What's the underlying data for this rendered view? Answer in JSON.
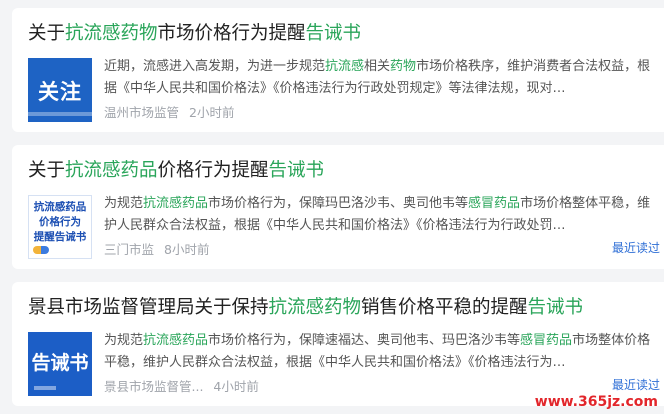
{
  "articles": [
    {
      "title_parts": [
        {
          "text": "关于",
          "hl": false
        },
        {
          "text": "抗流感药物",
          "hl": true
        },
        {
          "text": "市场价格行为提醒",
          "hl": false
        },
        {
          "text": "告诫书",
          "hl": true
        }
      ],
      "thumb_text": "关注",
      "summary_parts": [
        {
          "text": "近期，流感进入高发期，为进一步规范",
          "hl": false
        },
        {
          "text": "抗流感",
          "hl": true
        },
        {
          "text": "相关",
          "hl": false
        },
        {
          "text": "药物",
          "hl": true
        },
        {
          "text": "市场价格秩序，维护消费者合法权益，根据《中华人民共和国价格法》《价格违法行为行政处罚规定》等法律法规，现对…",
          "hl": false
        }
      ],
      "source": "温州市场监管",
      "time": "2小时前",
      "recent": ""
    },
    {
      "title_parts": [
        {
          "text": "关于",
          "hl": false
        },
        {
          "text": "抗流感药品",
          "hl": true
        },
        {
          "text": "价格行为提醒",
          "hl": false
        },
        {
          "text": "告诫书",
          "hl": true
        }
      ],
      "thumb_lines": [
        "抗流感药品",
        "价格行为",
        "提醒告诫书"
      ],
      "summary_parts": [
        {
          "text": "为规范",
          "hl": false
        },
        {
          "text": "抗流感药品",
          "hl": true
        },
        {
          "text": "市场价格行为，保障玛巴洛沙韦、奥司他韦等",
          "hl": false
        },
        {
          "text": "感冒药品",
          "hl": true
        },
        {
          "text": "市场价格整体平稳，维护人民群众合法权益，根据《中华人民共和国价格法》《价格违法行为行政处罚…",
          "hl": false
        }
      ],
      "source": "三门市监",
      "time": "8小时前",
      "recent": "最近读过"
    },
    {
      "title_parts": [
        {
          "text": "景县市场监督管理局关于保持",
          "hl": false
        },
        {
          "text": "抗流感药物",
          "hl": true
        },
        {
          "text": "销售价格平稳的提醒",
          "hl": false
        },
        {
          "text": "告诫书",
          "hl": true
        }
      ],
      "thumb_text": "告诫书",
      "summary_parts": [
        {
          "text": "为规范",
          "hl": false
        },
        {
          "text": "抗流感药品",
          "hl": true
        },
        {
          "text": "市场价格行为，保障速福达、奥司他韦、玛巴洛沙韦等",
          "hl": false
        },
        {
          "text": "感冒药品",
          "hl": true
        },
        {
          "text": "市场整体价格平稳，维护人民群众合法权益，根据《中华人民共和国价格法》《价格违法行为…",
          "hl": false
        }
      ],
      "source": "景县市场监督管...",
      "time": "4小时前",
      "recent": "最近读过"
    }
  ],
  "watermark": "www.365jz.com",
  "colors": {
    "highlight": "#2aa55a",
    "link": "#2f6fd6",
    "meta": "#a0a4ab"
  }
}
